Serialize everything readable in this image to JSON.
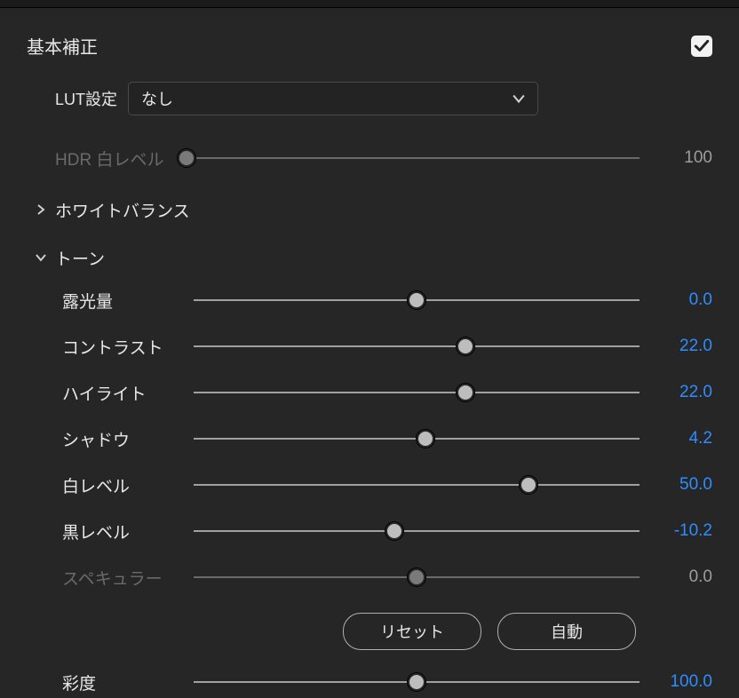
{
  "section": {
    "title": "基本補正",
    "enabled": true
  },
  "lut": {
    "label": "LUT設定",
    "selected": "なし"
  },
  "hdr": {
    "label": "HDR 白レベル",
    "value": "100",
    "pos": 0
  },
  "whiteBalance": {
    "label": "ホワイトバランス",
    "expanded": false
  },
  "tone": {
    "label": "トーン",
    "expanded": true,
    "sliders": {
      "exposure": {
        "label": "露光量",
        "value": "0.0",
        "pos": 50
      },
      "contrast": {
        "label": "コントラスト",
        "value": "22.0",
        "pos": 61
      },
      "highlights": {
        "label": "ハイライト",
        "value": "22.0",
        "pos": 61
      },
      "shadows": {
        "label": "シャドウ",
        "value": "4.2",
        "pos": 52
      },
      "whites": {
        "label": "白レベル",
        "value": "50.0",
        "pos": 75
      },
      "blacks": {
        "label": "黒レベル",
        "value": "-10.2",
        "pos": 45
      },
      "specular": {
        "label": "スペキュラー",
        "value": "0.0",
        "pos": 50,
        "disabled": true
      }
    },
    "buttons": {
      "reset": "リセット",
      "auto": "自動"
    }
  },
  "saturation": {
    "label": "彩度",
    "value": "100.0",
    "pos": 50
  }
}
